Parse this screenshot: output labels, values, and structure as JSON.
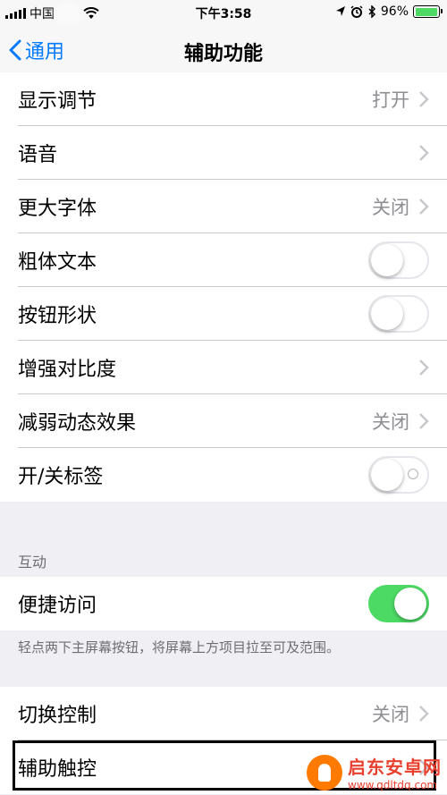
{
  "status_bar": {
    "carrier": "中国",
    "time": "下午3:58",
    "battery_percent": "96%",
    "battery_level": 0.96
  },
  "nav": {
    "back_label": "通用",
    "title": "辅助功能"
  },
  "group1": [
    {
      "label": "显示调节",
      "value": "打开",
      "kind": "chevron"
    },
    {
      "label": "语音",
      "value": "",
      "kind": "chevron"
    },
    {
      "label": "更大字体",
      "value": "关闭",
      "kind": "chevron"
    },
    {
      "label": "粗体文本",
      "kind": "toggle",
      "on": false
    },
    {
      "label": "按钮形状",
      "kind": "toggle",
      "on": false
    },
    {
      "label": "增强对比度",
      "value": "",
      "kind": "chevron"
    },
    {
      "label": "减弱动态效果",
      "value": "关闭",
      "kind": "chevron"
    },
    {
      "label": "开/关标签",
      "kind": "toggle",
      "on": false
    }
  ],
  "interaction": {
    "header": "互动",
    "reachability_label": "便捷访问",
    "reachability_on": true,
    "footer": "轻点两下主屏幕按钮，将屏幕上方项目拉至可及范围。"
  },
  "group3": [
    {
      "label": "切换控制",
      "value": "关闭",
      "kind": "chevron"
    },
    {
      "label": "辅助触控",
      "value": "",
      "kind": "chevron"
    }
  ],
  "watermark": {
    "name": "启东安卓网",
    "url": "www.qdltdq.com"
  },
  "colors": {
    "accent": "#007aff",
    "toggle_on": "#4cd964",
    "background": "#efeff4",
    "watermark": "#e8402e"
  }
}
